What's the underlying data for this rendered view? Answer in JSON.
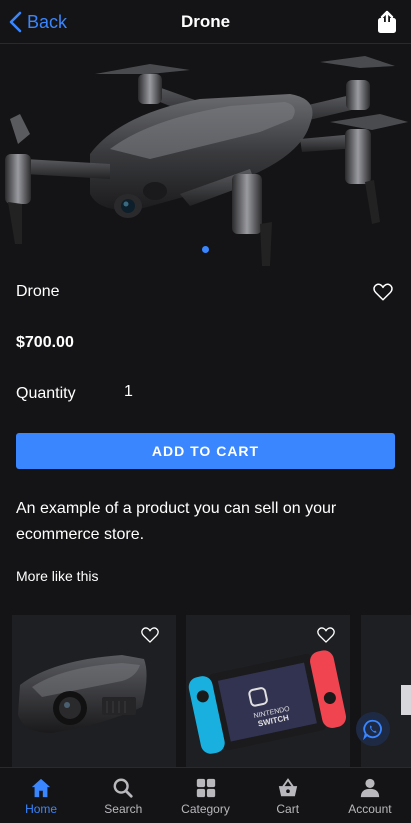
{
  "header": {
    "back_label": "Back",
    "title": "Drone"
  },
  "product": {
    "name": "Drone",
    "price": "$700.00",
    "quantity_label": "Quantity",
    "quantity_value": "1",
    "add_to_cart_label": "ADD TO CART",
    "description": "An example of a product you can sell on your ecommerce store."
  },
  "carousel": {
    "image_count": 1,
    "active_index": 0
  },
  "related": {
    "title": "More like this",
    "items": [
      {
        "image": "projector"
      },
      {
        "image": "nintendo-switch"
      },
      {
        "image": "partial-product"
      }
    ]
  },
  "tabs": [
    {
      "label": "Home",
      "icon": "home-icon",
      "active": true
    },
    {
      "label": "Search",
      "icon": "search-icon",
      "active": false
    },
    {
      "label": "Category",
      "icon": "grid-icon",
      "active": false
    },
    {
      "label": "Cart",
      "icon": "basket-icon",
      "active": false
    },
    {
      "label": "Account",
      "icon": "person-icon",
      "active": false
    }
  ],
  "colors": {
    "accent": "#3a86ff",
    "background": "#141416",
    "card": "#1e1f22"
  }
}
